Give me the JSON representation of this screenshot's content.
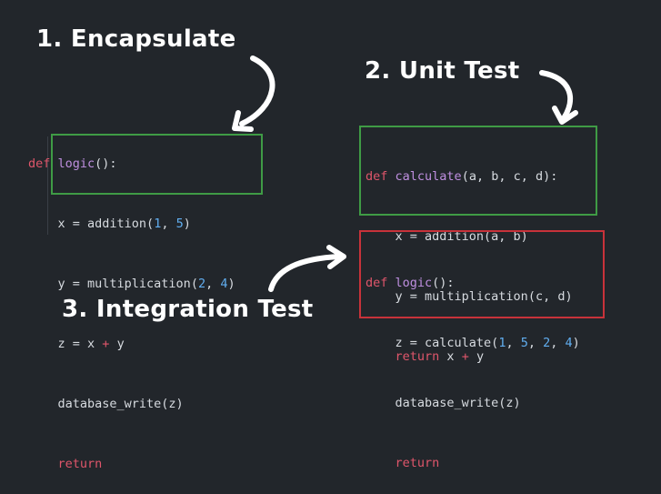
{
  "steps": {
    "step1": "1. Encapsulate",
    "step2": "2. Unit Test",
    "step3": "3. Integration Test"
  },
  "snippet_original": {
    "def_kw": "def",
    "fn_name": "logic",
    "fn_sig_rest": "():",
    "line_x": {
      "lhs": "x = addition(",
      "arg1": "1",
      "sep": ", ",
      "arg2": "5",
      "end": ")"
    },
    "line_y": {
      "lhs": "y = multiplication(",
      "arg1": "2",
      "sep": ", ",
      "arg2": "4",
      "end": ")"
    },
    "line_z": {
      "lhs": "z = x ",
      "op": "+",
      "rhs": " y"
    },
    "line_db": "database_write(z)",
    "line_return": "return"
  },
  "snippet_unit": {
    "def_kw": "def",
    "fn_name": "calculate",
    "fn_sig_rest": "(a, b, c, d):",
    "line_x": "x = addition(a, b)",
    "line_y": "y = multiplication(c, d)",
    "line_return_kw": "return",
    "line_return_expr_a": " x ",
    "line_return_op": "+",
    "line_return_expr_b": " y"
  },
  "snippet_integration": {
    "def_kw": "def",
    "fn_name": "logic",
    "fn_sig_rest": "():",
    "line_z": {
      "lhs": "z = calculate(",
      "a1": "1",
      "s1": ", ",
      "a2": "5",
      "s2": ", ",
      "a3": "2",
      "s3": ", ",
      "a4": "4",
      "end": ")"
    },
    "line_db": "database_write(z)",
    "line_return": "return"
  },
  "colors": {
    "background": "#22262b",
    "unit_box": "#3f9b45",
    "integration_box": "#c8323a",
    "keyword": "#e0566b",
    "function_name": "#bf8fe0",
    "number": "#61aef0"
  },
  "icons": [
    "curved-arrow-down-left-icon",
    "curved-arrow-down-right-icon",
    "curved-arrow-up-right-icon"
  ]
}
